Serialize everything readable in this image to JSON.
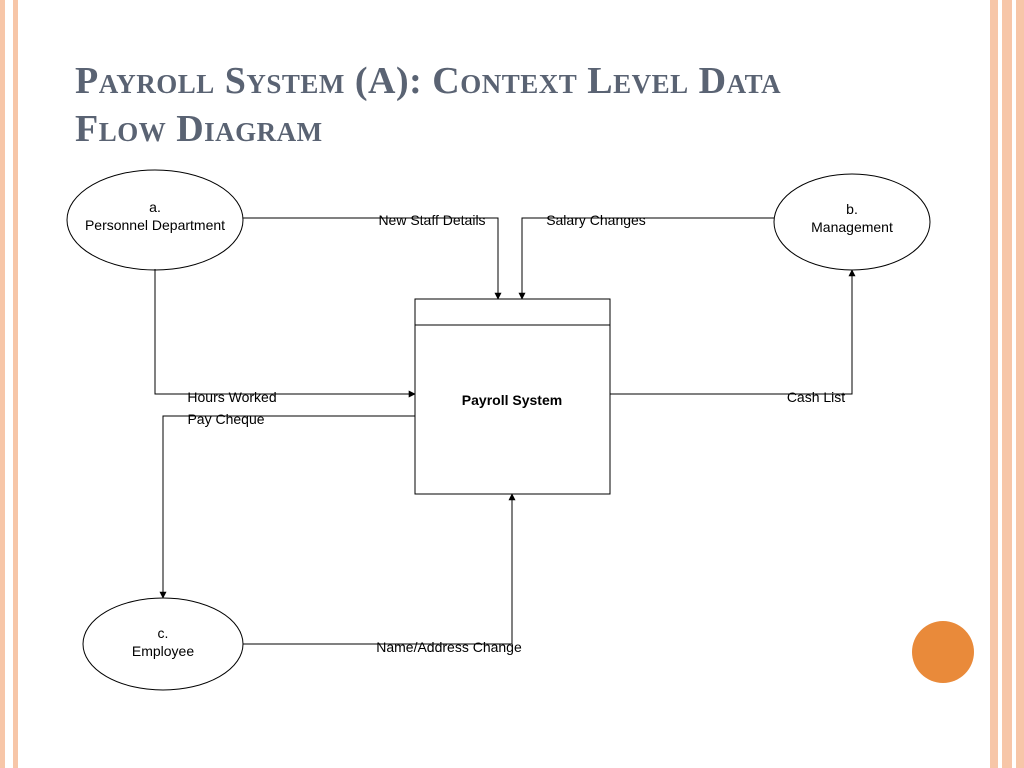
{
  "title": "Payroll System (A): Context Level Data Flow Diagram",
  "entities": {
    "a": {
      "tag": "a.",
      "name": "Personnel Department"
    },
    "b": {
      "tag": "b.",
      "name": "Management"
    },
    "c": {
      "tag": "c.",
      "name": "Employee"
    }
  },
  "process": {
    "name": "Payroll System"
  },
  "flows": {
    "new_staff": "New Staff Details",
    "salary_changes": "Salary Changes",
    "hours_worked": "Hours Worked",
    "pay_cheque": "Pay Cheque",
    "cash_list": "Cash List",
    "name_addr": "Name/Address Change"
  }
}
